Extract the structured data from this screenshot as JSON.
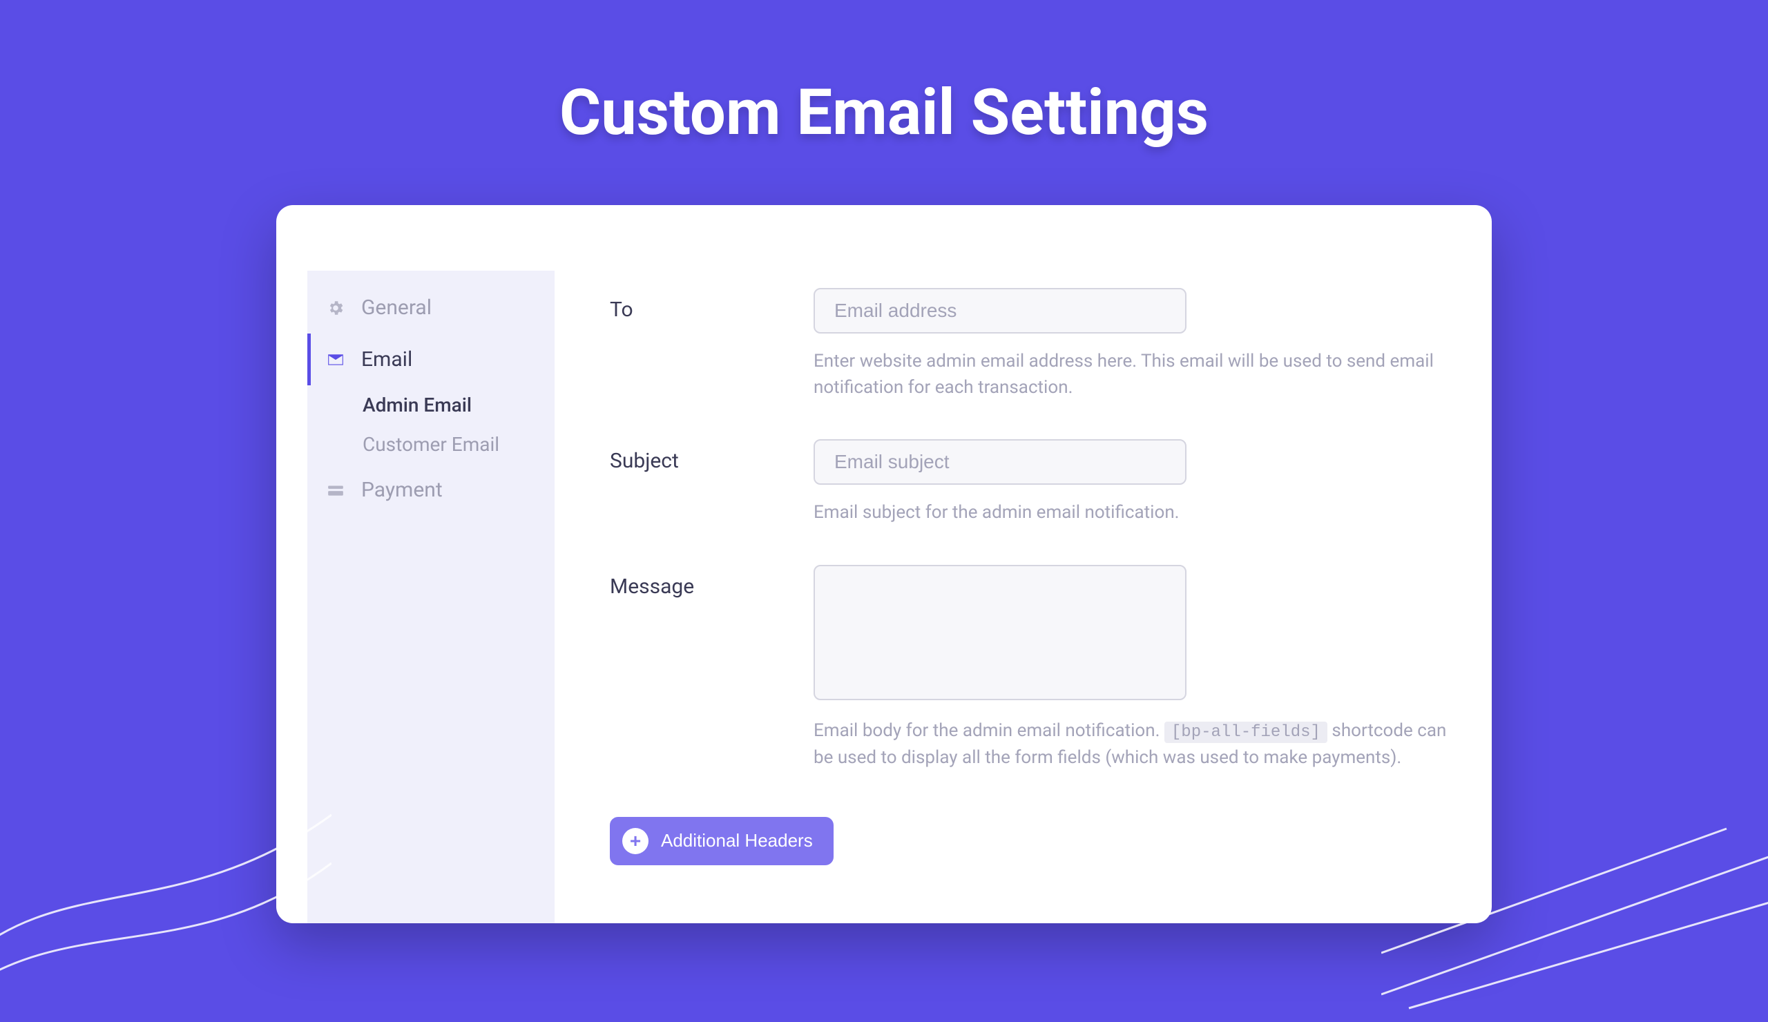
{
  "page_title": "Custom Email Settings",
  "sidebar": {
    "items": [
      {
        "icon": "gear-icon",
        "label": "General",
        "active": false
      },
      {
        "icon": "envelope-icon",
        "label": "Email",
        "active": true,
        "children": [
          {
            "label": "Admin Email",
            "active": true
          },
          {
            "label": "Customer Email",
            "active": false
          }
        ]
      },
      {
        "icon": "payment-icon",
        "label": "Payment",
        "active": false
      }
    ]
  },
  "form": {
    "to": {
      "label": "To",
      "placeholder": "Email address",
      "helper": "Enter website admin email address here. This email will be used to send email notification for each transaction."
    },
    "subject": {
      "label": "Subject",
      "placeholder": "Email subject",
      "helper": "Email subject for the admin email notification."
    },
    "message": {
      "label": "Message",
      "helper_pre": "Email body for the admin email notification. ",
      "shortcode": "[bp-all-fields]",
      "helper_post": " shortcode can be used to display all the form fields (which was used to make payments)."
    },
    "additional_headers_label": "Additional Headers"
  }
}
